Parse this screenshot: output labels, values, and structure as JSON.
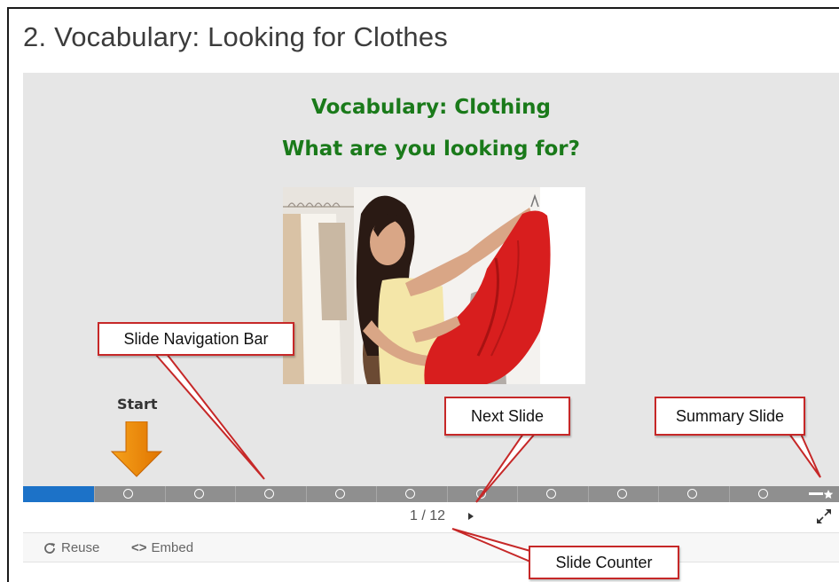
{
  "page": {
    "title": "2. Vocabulary: Looking for Clothes"
  },
  "slide": {
    "heading": "Vocabulary: Clothing",
    "subheading": "What are you looking for?",
    "image_alt": "woman-holding-red-dress-photo",
    "start_label": "Start"
  },
  "navigation": {
    "current_slide": 1,
    "total_slides": 12,
    "counter_text": "1 / 12",
    "segment_count": 10,
    "progress_fraction": 0.087
  },
  "footer": {
    "reuse_label": "Reuse",
    "embed_label": "Embed",
    "embed_icon_text": "<>"
  },
  "callouts": {
    "nav_bar": "Slide Navigation Bar",
    "next_slide": "Next Slide",
    "summary_slide": "Summary Slide",
    "slide_counter": "Slide Counter"
  },
  "colors": {
    "heading_green": "#1a7a1a",
    "progress_blue": "#1c72c8",
    "callout_border": "#c62828",
    "start_arrow_orange": "#f08a00",
    "dress_red": "#d81e1e"
  },
  "icons": [
    "refresh-icon",
    "embed-icon",
    "play-next-icon",
    "fullscreen-icon",
    "summary-star-icon",
    "start-arrow-icon"
  ]
}
